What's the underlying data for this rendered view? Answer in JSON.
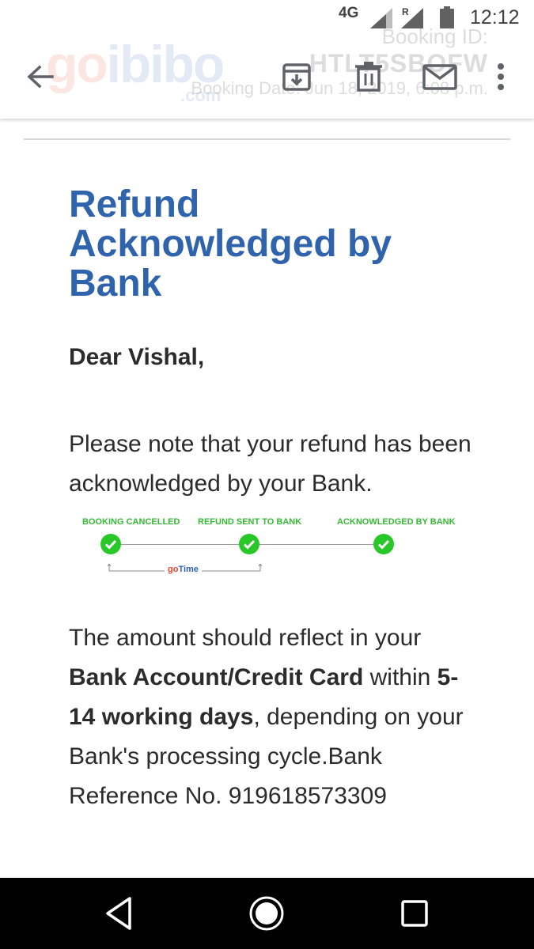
{
  "status_bar": {
    "network": "4G",
    "roaming": "R",
    "time": "12:12"
  },
  "background_header": {
    "logo_go": "go",
    "logo_ibibo": "ibibo",
    "logo_com": ".com",
    "booking_id_label": "Booking ID:",
    "booking_id": "HTLT5SBOFW",
    "booking_date": "Booking Date: Jun 18, 2019, 6:08 p.m."
  },
  "toolbar": {
    "icons": [
      "arrow-back-icon",
      "archive-icon",
      "delete-icon",
      "mail-icon",
      "more-vert-icon"
    ]
  },
  "email": {
    "headline": "Refund Acknowledged by Bank",
    "greeting": "Dear Vishal,",
    "intro": "Please note that your refund has been acknowledged by your Bank.",
    "body_part1": "The amount should reflect in your",
    "body_bold1": "Bank Account/Credit Card",
    "body_part2": "within",
    "body_bold2": "5-14 working days",
    "body_part3": ", depending on your Bank's processing cycle.Bank Reference No. 919618573309"
  },
  "tracker": {
    "steps": [
      {
        "label": "BOOKING CANCELLED",
        "done": true
      },
      {
        "label": "REFUND SENT TO BANK",
        "done": true
      },
      {
        "label": "ACKNOWLEDGED BY BANK",
        "done": true
      }
    ],
    "gotime_go": "go",
    "gotime_time": "Time",
    "step_color": "#36b936",
    "check_color": "#28c828"
  },
  "colors": {
    "headline": "#2f64ad",
    "text": "#2b2b2b",
    "brand_red": "#e8432b",
    "brand_blue": "#2d62b6"
  },
  "nav_bar": {
    "icons": [
      "nav-back-icon",
      "nav-home-icon",
      "nav-recents-icon"
    ]
  }
}
